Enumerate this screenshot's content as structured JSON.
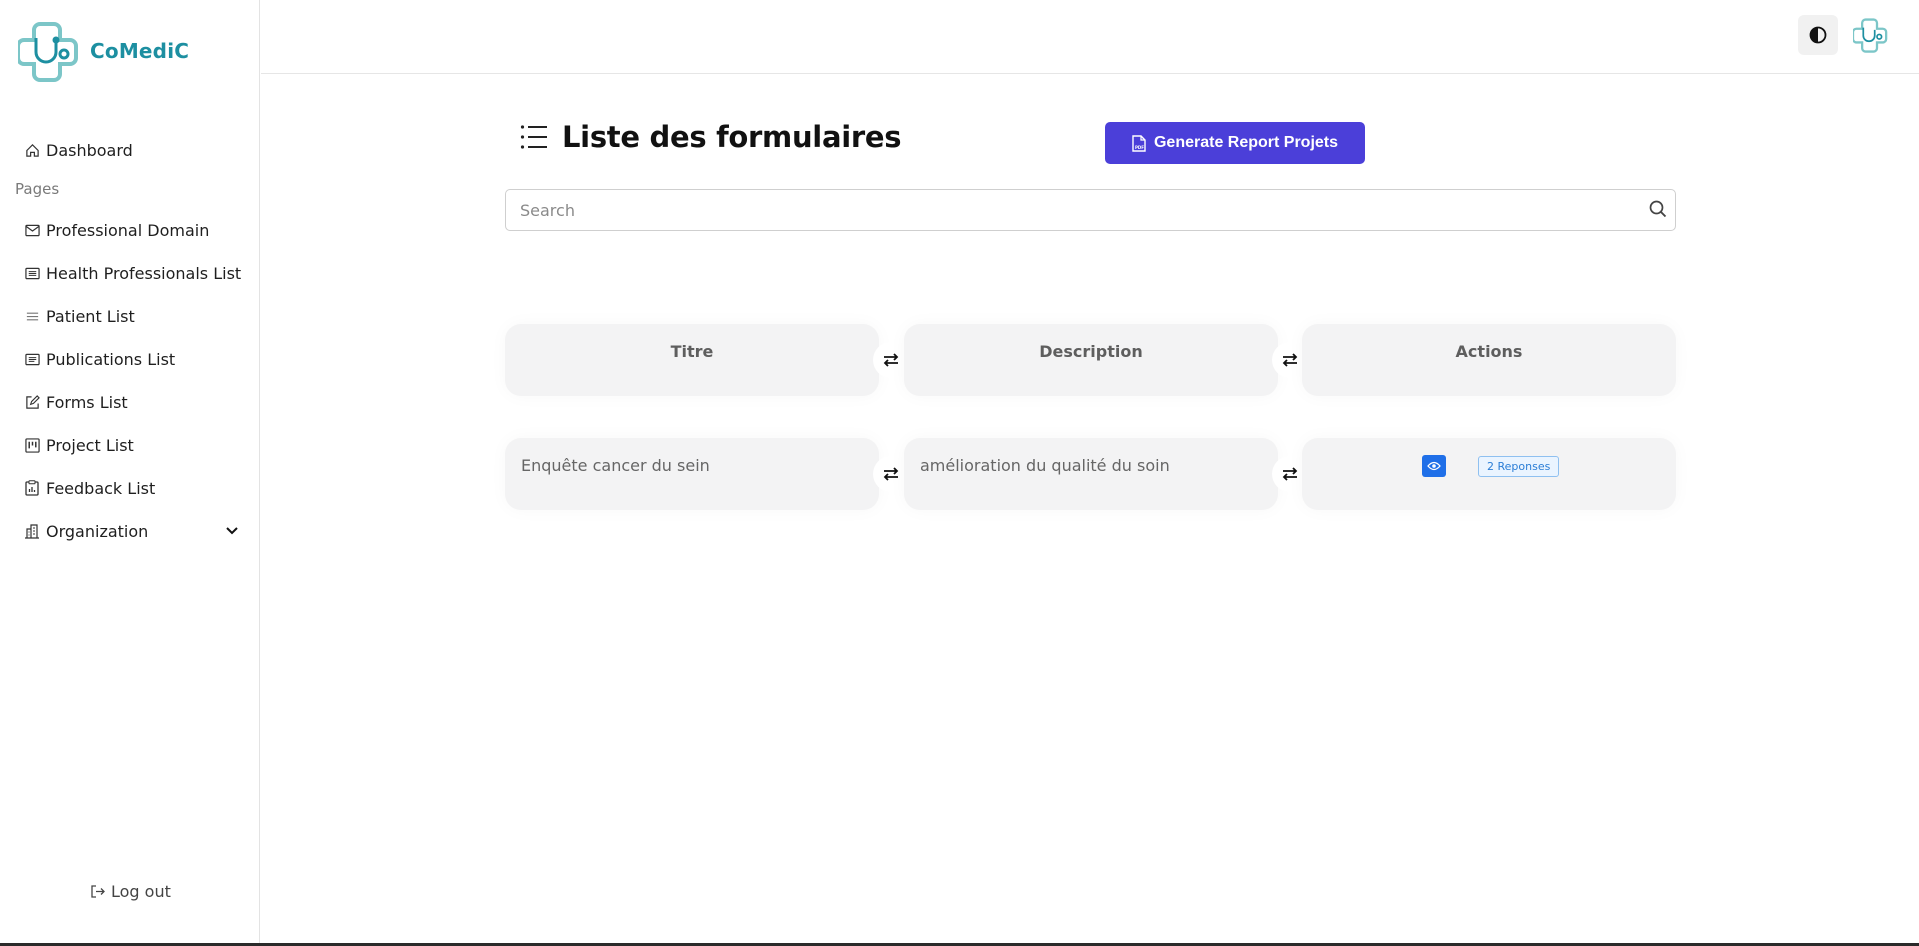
{
  "app": {
    "name": "CoMediC"
  },
  "sidebar": {
    "dashboard": {
      "label": "Dashboard",
      "icon": "home-icon"
    },
    "section_label": "Pages",
    "items": [
      {
        "label": "Professional Domain",
        "icon": "envelope-icon"
      },
      {
        "label": "Health Professionals List",
        "icon": "list-card-icon"
      },
      {
        "label": "Patient List",
        "icon": "lines-icon"
      },
      {
        "label": "Publications List",
        "icon": "list-card-icon"
      },
      {
        "label": "Forms List",
        "icon": "edit-icon"
      },
      {
        "label": "Project List",
        "icon": "kanban-icon"
      },
      {
        "label": "Feedback List",
        "icon": "clipboard-chart-icon"
      },
      {
        "label": "Organization",
        "icon": "building-icon"
      }
    ],
    "logout_label": "Log out"
  },
  "main": {
    "title": "Liste des formulaires",
    "report_button_label": "Generate Report Projets",
    "search": {
      "placeholder": "Search",
      "value": ""
    },
    "table": {
      "headers": [
        "Titre",
        "Description",
        "Actions"
      ],
      "rows": [
        {
          "titre": "Enquête cancer du sein",
          "description": "amélioration du qualité du soin",
          "responses_label": "2 Reponses"
        }
      ]
    }
  },
  "colors": {
    "brand": "#1d8fa1",
    "primary_button": "#4b3fd9",
    "view_button": "#1f6fe8"
  }
}
